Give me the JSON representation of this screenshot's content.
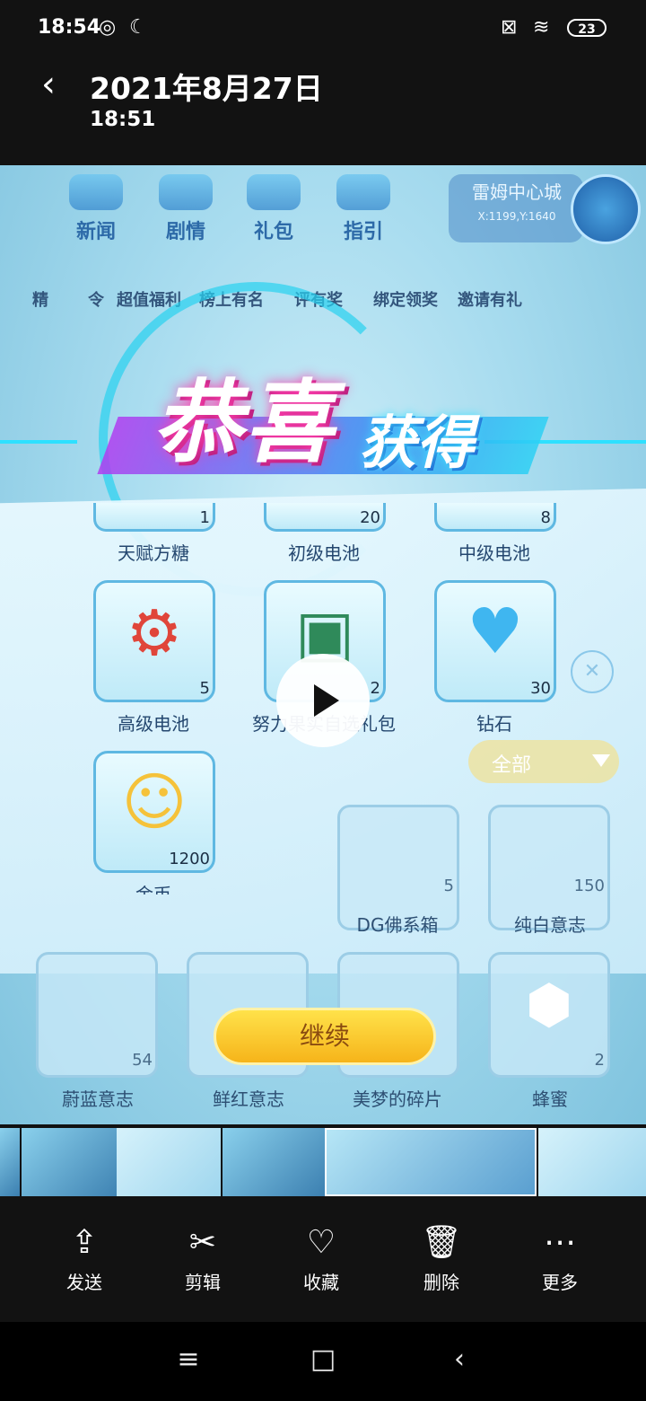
{
  "status_bar": {
    "time": "18:54",
    "battery": "23"
  },
  "header": {
    "back_glyph": "‹",
    "date": "2021年8月27日",
    "time": "18:51"
  },
  "game": {
    "top_nav": [
      "新闻",
      "剧情",
      "礼包",
      "指引"
    ],
    "location": {
      "name": "雷姆中心城",
      "coords": "X:1199,Y:1640"
    },
    "menu_row": [
      "精",
      "令",
      "超值福利",
      "榜上有名",
      "评有奖",
      "绑定领奖",
      "邀请有礼"
    ],
    "congrats_big": "恭喜",
    "congrats_small": "获得",
    "rewards": [
      {
        "name": "天赋方糖",
        "count": "1"
      },
      {
        "name": "初级电池",
        "count": "20"
      },
      {
        "name": "中级电池",
        "count": "8"
      },
      {
        "name": "高级电池",
        "count": "5"
      },
      {
        "name": "努力果实自选礼包",
        "count": "2"
      },
      {
        "name": "钻石",
        "count": "30"
      },
      {
        "name": "金币",
        "count": "1200"
      }
    ],
    "filter_label": "全部",
    "bg_items": [
      {
        "name": "DG佛系箱",
        "count": "5"
      },
      {
        "name": "纯白意志",
        "count": "150"
      },
      {
        "name": "蔚蓝意志",
        "count": "54"
      },
      {
        "name": "鲜红意志",
        "count": ""
      },
      {
        "name": "美梦的碎片",
        "count": ""
      },
      {
        "name": "蜂蜜",
        "count": "2"
      }
    ],
    "continue_label": "继续"
  },
  "actions": [
    {
      "label": "发送",
      "icon": "share-icon"
    },
    {
      "label": "剪辑",
      "icon": "scissors-icon"
    },
    {
      "label": "收藏",
      "icon": "heart-icon"
    },
    {
      "label": "删除",
      "icon": "trash-icon"
    },
    {
      "label": "更多",
      "icon": "more-icon"
    }
  ],
  "nav": {
    "menu": "≡",
    "home": "□",
    "back": "‹"
  }
}
